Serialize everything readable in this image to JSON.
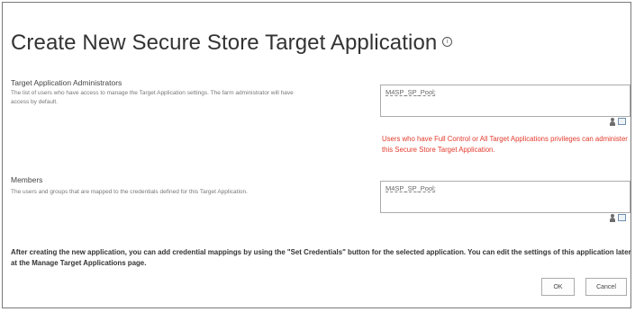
{
  "page": {
    "title": "Create New Secure Store Target Application"
  },
  "administrators": {
    "heading": "Target Application Administrators",
    "description": "The list of users who have access to manage the Target Application settings. The farm administrator will have access by default.",
    "value": "M4SP_SP_Pool;",
    "warning": "Users who have Full Control or All Target Applications privileges can administer this Secure Store Target Application."
  },
  "members": {
    "heading": "Members",
    "description": "The users and groups that are mapped to the credentials defined for this Target Application.",
    "value": "M4SP_SP_Pool;"
  },
  "note": "After creating the new application, you can add credential mappings by using the \"Set Credentials\" button for the selected application. You can edit the settings of this application later at the Manage Target Applications page.",
  "buttons": {
    "ok": "OK",
    "cancel": "Cancel"
  },
  "icons": {
    "info": "info-icon",
    "check_names": "check-names-icon",
    "browse": "browse-icon"
  },
  "colors": {
    "warning": "#e33b2e",
    "border": "#ababab"
  }
}
